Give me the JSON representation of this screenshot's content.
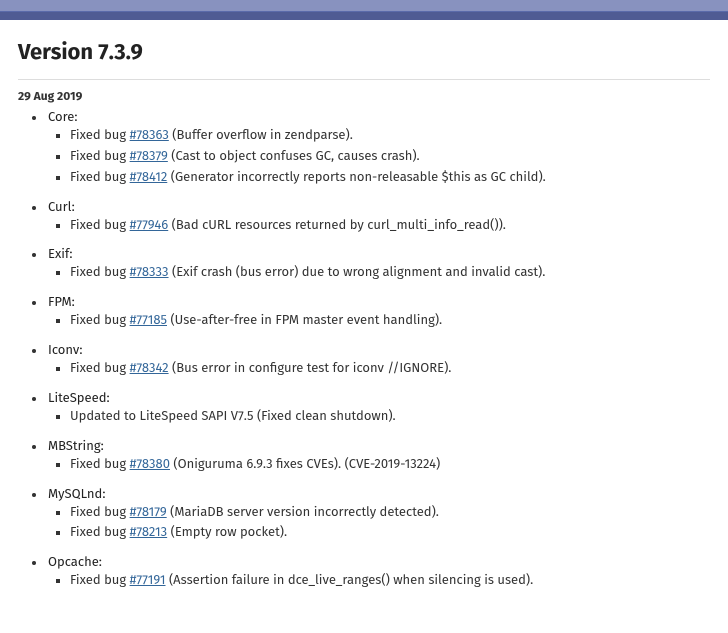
{
  "version_heading": "Version 7.3.9",
  "release_date": "29 Aug 2019",
  "labels": {
    "fixed_bug_prefix": "Fixed bug "
  },
  "modules": [
    {
      "name": "Core:",
      "items": [
        {
          "type": "bug",
          "bug": "#78363",
          "desc": " (Buffer overflow in zendparse)."
        },
        {
          "type": "bug",
          "bug": "#78379",
          "desc": " (Cast to object confuses GC, causes crash)."
        },
        {
          "type": "bug",
          "bug": "#78412",
          "desc": " (Generator incorrectly reports non-releasable $this as GC child)."
        }
      ]
    },
    {
      "name": "Curl:",
      "items": [
        {
          "type": "bug",
          "bug": "#77946",
          "desc": " (Bad cURL resources returned by curl_multi_info_read())."
        }
      ]
    },
    {
      "name": "Exif:",
      "items": [
        {
          "type": "bug",
          "bug": "#78333",
          "desc": " (Exif crash (bus error) due to wrong alignment and invalid cast)."
        }
      ]
    },
    {
      "name": "FPM:",
      "items": [
        {
          "type": "bug",
          "bug": "#77185",
          "desc": " (Use-after-free in FPM master event handling)."
        }
      ]
    },
    {
      "name": "Iconv:",
      "items": [
        {
          "type": "bug",
          "bug": "#78342",
          "desc": " (Bus error in configure test for iconv //IGNORE)."
        }
      ]
    },
    {
      "name": "LiteSpeed:",
      "items": [
        {
          "type": "note",
          "desc": "Updated to LiteSpeed SAPI V7.5 (Fixed clean shutdown)."
        }
      ]
    },
    {
      "name": "MBString:",
      "items": [
        {
          "type": "bug",
          "bug": "#78380",
          "desc": " (Oniguruma 6.9.3 fixes CVEs). (CVE-2019-13224)"
        }
      ]
    },
    {
      "name": "MySQLnd:",
      "items": [
        {
          "type": "bug",
          "bug": "#78179",
          "desc": " (MariaDB server version incorrectly detected)."
        },
        {
          "type": "bug",
          "bug": "#78213",
          "desc": " (Empty row pocket)."
        }
      ]
    },
    {
      "name": "Opcache:",
      "items": [
        {
          "type": "bug",
          "bug": "#77191",
          "desc": " (Assertion failure in dce_live_ranges() when silencing is used)."
        }
      ]
    }
  ]
}
